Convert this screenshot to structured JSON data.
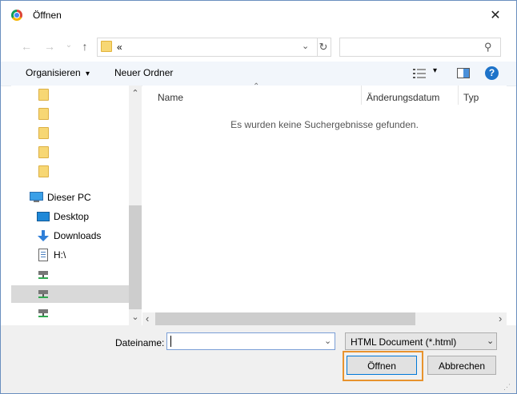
{
  "window": {
    "title": "Öffnen",
    "close_glyph": "✕"
  },
  "nav": {
    "back": "←",
    "forward": "→",
    "recent": "⌄",
    "up": "↑"
  },
  "address": {
    "crumb": "«",
    "dropdown": "⌄",
    "refresh": "↻"
  },
  "search": {
    "placeholder": ""
  },
  "toolbar": {
    "organize_label": "Organisieren",
    "organize_arrow": "▾",
    "new_folder_label": "Neuer Ordner",
    "view_arrow": "▾",
    "help": "?"
  },
  "sidebar": {
    "this_pc": "Dieser PC",
    "desktop": "Desktop",
    "downloads": "Downloads",
    "drive_h": "H:\\",
    "scroll_up": "⌃",
    "scroll_down": "⌄"
  },
  "filelist": {
    "columns": {
      "name": "Name",
      "modified": "Änderungsdatum",
      "type": "Typ"
    },
    "sort_arrow": "⌃",
    "empty_message": "Es wurden keine Suchergebnisse gefunden.",
    "scroll_left": "‹",
    "scroll_right": "›"
  },
  "footer": {
    "filename_label": "Dateiname:",
    "filename_value": "",
    "filename_dropdown": "⌄",
    "filter_value": "HTML Document (*.html)",
    "filter_dropdown": "⌄",
    "open_label": "Öffnen",
    "cancel_label": "Abbrechen"
  },
  "colors": {
    "toolbar_bg": "#f2f6fb",
    "focus_ring": "#e8932e",
    "primary_border": "#0078d7",
    "folder": "#f7d774",
    "help": "#1e73c9"
  }
}
